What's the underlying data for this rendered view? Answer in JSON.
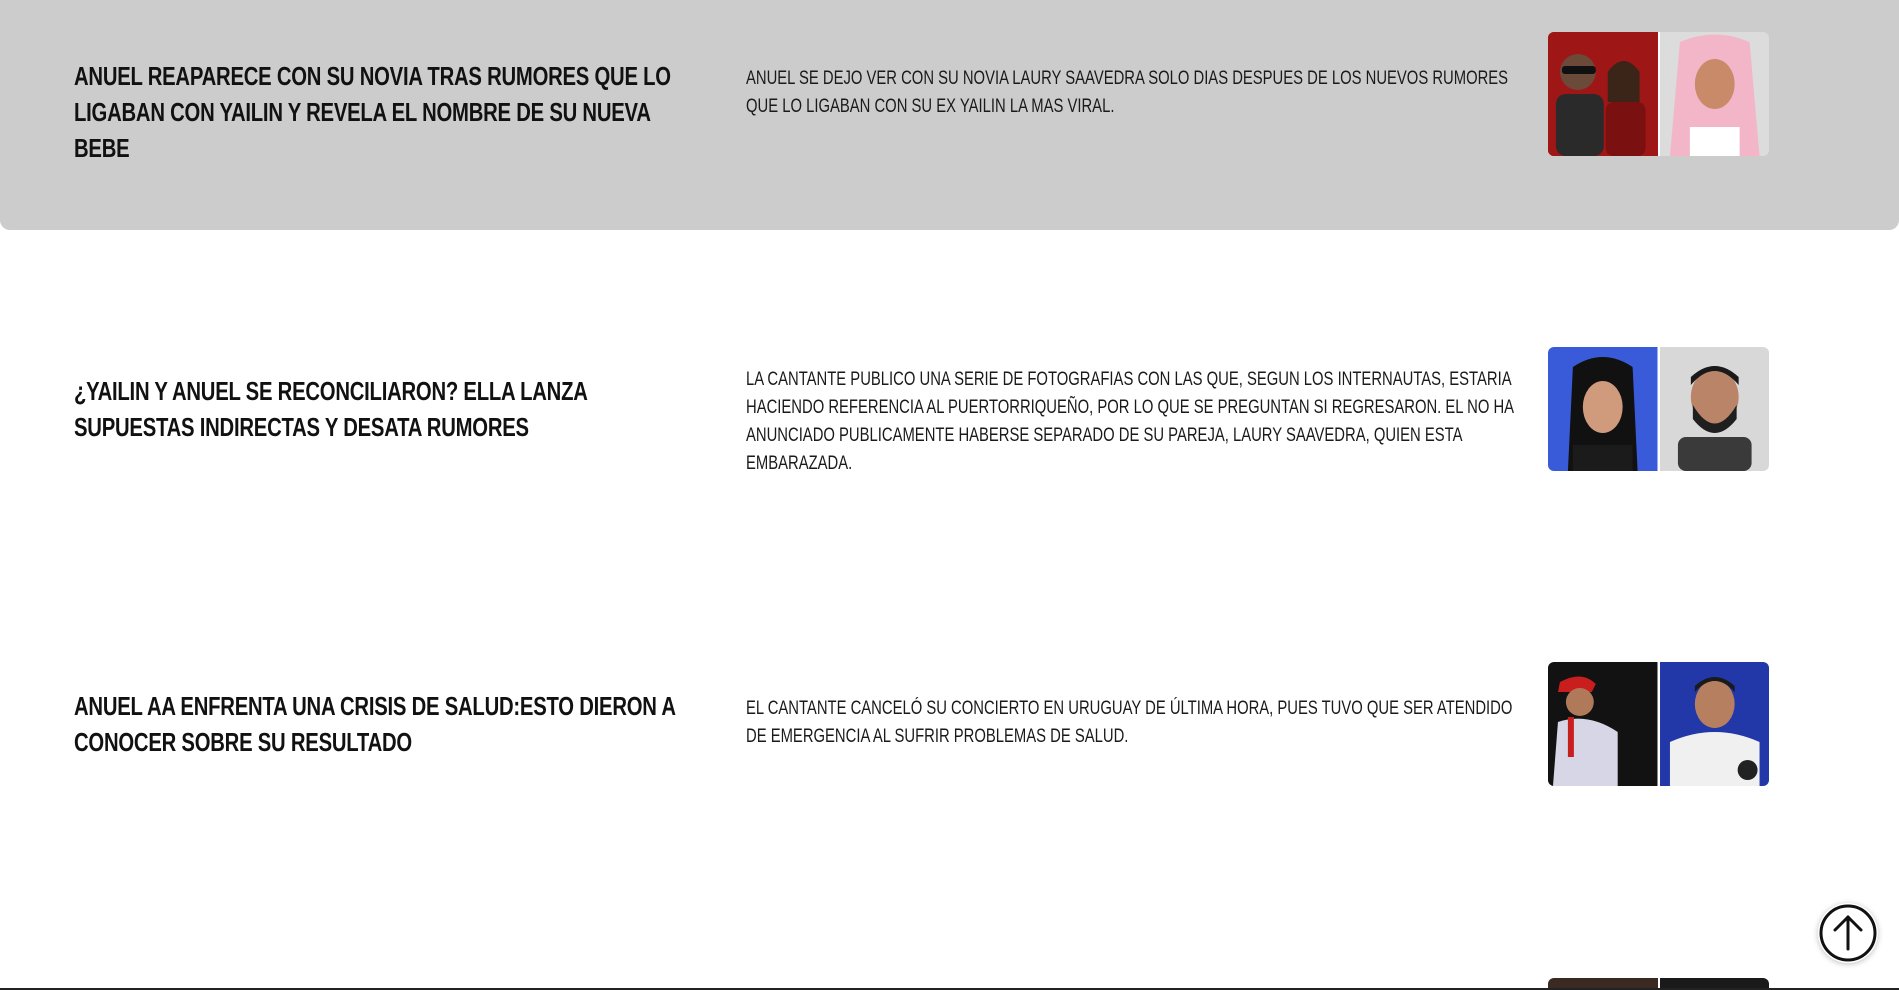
{
  "articles": [
    {
      "title": "ANUEL REAPARECE CON SU NOVIA TRAS RUMORES QUE LO LIGABAN CON YAILIN Y REVELA EL NOMBRE DE SU NUEVA BEBE",
      "description": "ANUEL SE DEJO VER CON SU NOVIA LAURY SAAVEDRA SOLO DIAS DESPUES DE LOS NUEVOS RUMORES QUE LO LIGABAN CON SU EX YAILIN LA MAS VIRAL.",
      "highlighted": true,
      "thumb_colors": [
        "#b31b1b",
        "#e8b8c8"
      ]
    },
    {
      "title": "¿YAILIN Y ANUEL SE RECONCILIARON? ELLA LANZA SUPUESTAS INDIRECTAS Y DESATA RUMORES",
      "description": "LA CANTANTE PUBLICO UNA SERIE DE FOTOGRAFIAS CON LAS QUE, SEGUN LOS INTERNAUTAS, ESTARIA HACIENDO REFERENCIA AL PUERTORRIQUEÑO, POR LO QUE SE PREGUNTAN SI REGRESARON. EL NO HA ANUNCIADO PUBLICAMENTE HABERSE SEPARADO DE SU PAREJA, LAURY SAAVEDRA, QUIEN ESTA EMBARAZADA.",
      "highlighted": false,
      "thumb_colors": [
        "#3a5bd9",
        "#d9d9d9"
      ]
    },
    {
      "title": "ANUEL AA ENFRENTA UNA CRISIS DE SALUD:ESTO DIERON A CONOCER SOBRE SU RESULTADO",
      "description": "EL CANTANTE CANCELÓ SU CONCIERTO EN URUGUAY DE ÚLTIMA HORA, PUES TUVO QUE SER ATENDIDO DE EMERGENCIA AL SUFRIR PROBLEMAS DE SALUD.",
      "highlighted": false,
      "thumb_colors": [
        "#151515",
        "#2338a8"
      ]
    }
  ],
  "scroll_top_icon": "arrow-up-circle-icon"
}
